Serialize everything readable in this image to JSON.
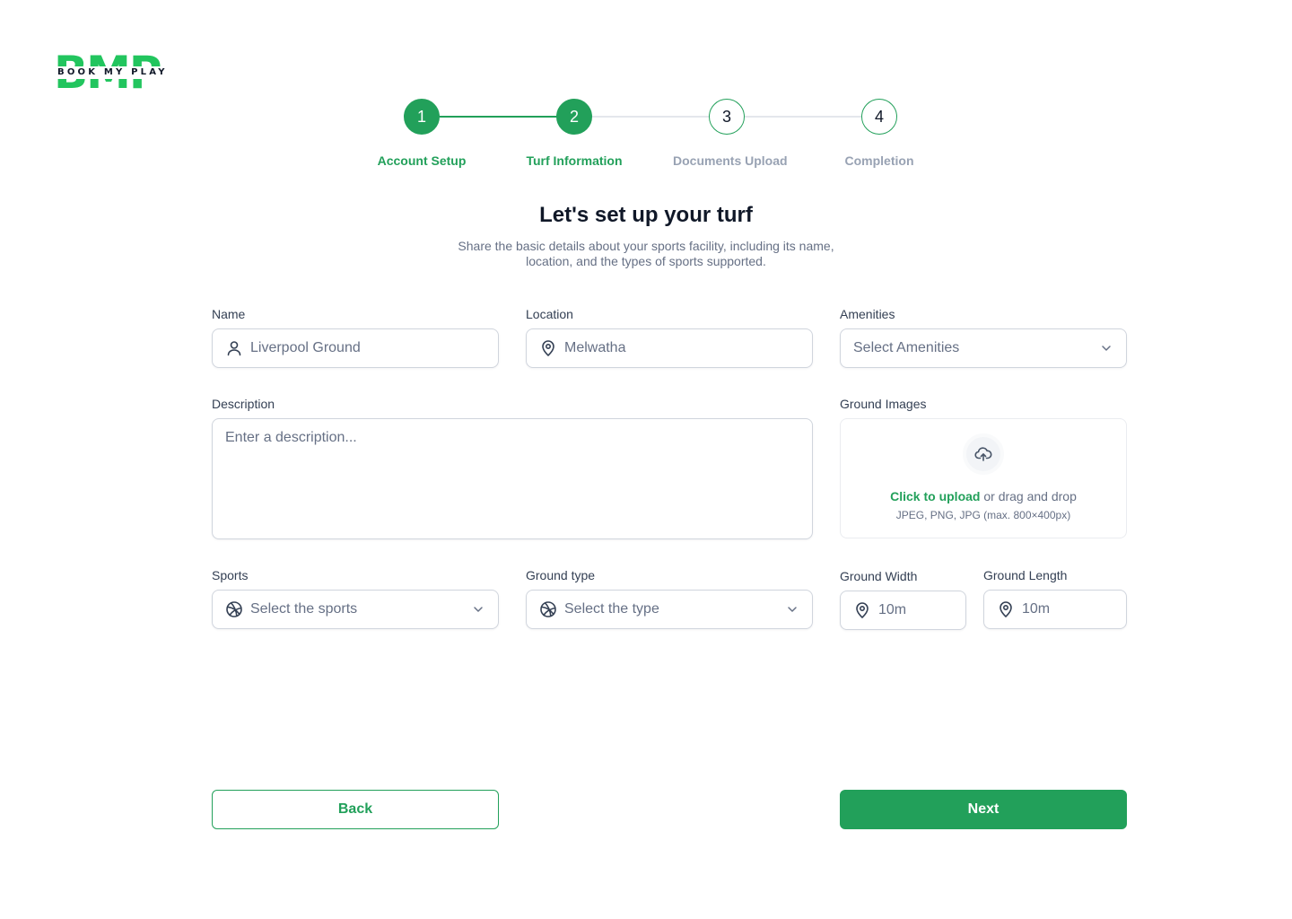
{
  "brand": {
    "letters": "BMP",
    "tagline": "BOOK MY PLAY"
  },
  "stepper": {
    "steps": [
      {
        "number": "1",
        "label": "Account Setup",
        "state": "completed"
      },
      {
        "number": "2",
        "label": "Turf Information",
        "state": "current"
      },
      {
        "number": "3",
        "label": "Documents Upload",
        "state": "upcoming"
      },
      {
        "number": "4",
        "label": "Completion",
        "state": "upcoming"
      }
    ]
  },
  "heading": {
    "title": "Let's set up your turf",
    "subtitle": "Share the basic details about your sports facility, including its name, location, and the types of sports supported."
  },
  "form": {
    "name": {
      "label": "Name",
      "value": "Liverpool Ground",
      "icon": "user-icon"
    },
    "location": {
      "label": "Location",
      "value": "Melwatha",
      "icon": "map-pin-icon"
    },
    "amenities": {
      "label": "Amenities",
      "placeholder": "Select Amenities"
    },
    "description": {
      "label": "Description",
      "placeholder": "Enter a description..."
    },
    "ground_images": {
      "label": "Ground Images",
      "link_text": "Click to upload",
      "rest_text": " or drag and drop",
      "hint": "JPEG, PNG, JPG (max. 800×400px)"
    },
    "sports": {
      "label": "Sports",
      "placeholder": "Select the sports",
      "icon": "ball-icon"
    },
    "ground_type": {
      "label": "Ground type",
      "placeholder": "Select the type",
      "icon": "ball-icon"
    },
    "ground_width": {
      "label": "Ground Width",
      "value": "10m",
      "icon": "map-pin-icon"
    },
    "ground_length": {
      "label": "Ground Length",
      "value": "10m",
      "icon": "map-pin-icon"
    }
  },
  "actions": {
    "back_label": "Back",
    "next_label": "Next"
  },
  "colors": {
    "accent": "#22a05a",
    "logo": "#22c55e",
    "border": "#d0d5dd",
    "text_muted": "#667085",
    "step_inactive": "#98a2b3"
  }
}
